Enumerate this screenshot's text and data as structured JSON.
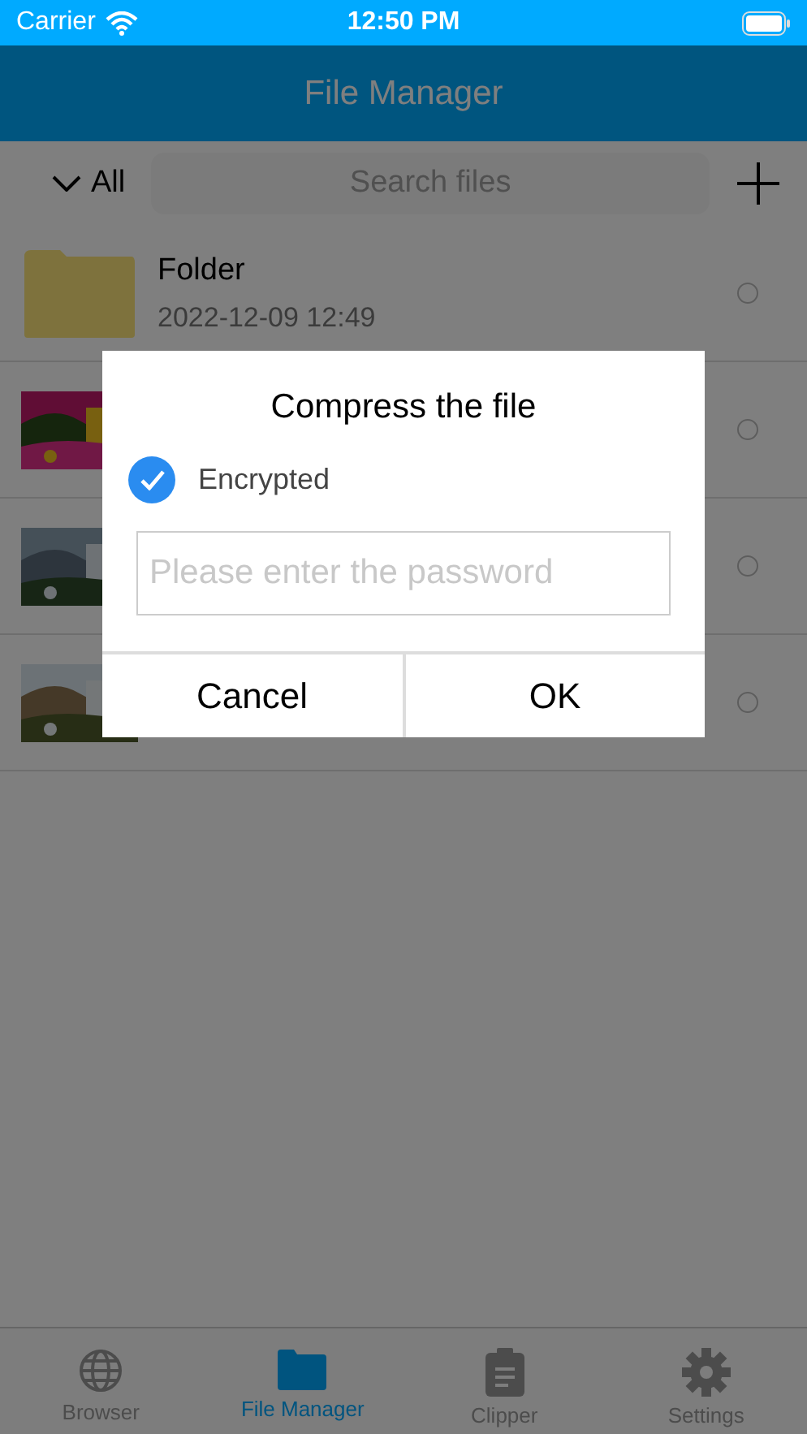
{
  "status_bar": {
    "carrier": "Carrier",
    "time": "12:50 PM"
  },
  "nav": {
    "title": "File Manager"
  },
  "toolbar": {
    "filter": "All",
    "search": {
      "placeholder": "Search files"
    }
  },
  "files": [
    {
      "kind": "folder",
      "name": "Folder",
      "date": "2022-12-09 12:49",
      "selected": false
    },
    {
      "kind": "picture",
      "selected": false
    },
    {
      "kind": "picture",
      "selected": false
    },
    {
      "kind": "picture",
      "selected": false
    }
  ],
  "dialog": {
    "title": "Compress the file",
    "encrypted": {
      "label": "Encrypted",
      "checked": true
    },
    "password": {
      "placeholder": "Please enter the password"
    },
    "buttons": [
      "Cancel",
      "OK"
    ]
  },
  "tabs": [
    {
      "label": "Browser",
      "kind": "globe",
      "selected": false
    },
    {
      "label": "File Manager",
      "kind": "folder",
      "selected": true
    },
    {
      "label": "Clipper",
      "kind": "clipboard",
      "selected": false
    },
    {
      "label": "Settings",
      "kind": "gear",
      "selected": false
    }
  ]
}
